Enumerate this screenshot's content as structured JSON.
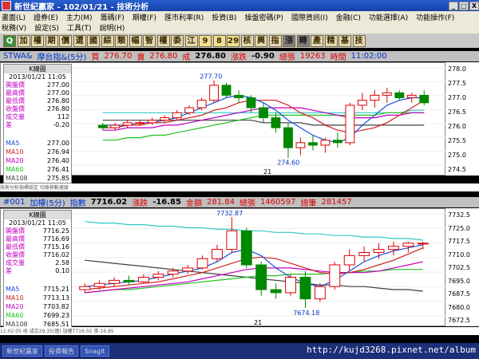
{
  "window": {
    "title": "新世紀贏家 - 102/01/21 - 技術分析",
    "buttons": [
      "_",
      "□",
      "X"
    ]
  },
  "menu": {
    "row1": [
      "畫面(L)",
      "證券(E)",
      "主力(M)",
      "籌碼(F)",
      "期權(F)",
      "匯市利率(R)",
      "投資(B)",
      "操盤密碼(P)",
      "國際資訊(I)",
      "金融(C)",
      "功能選擇(A)",
      "功能操作(F)"
    ],
    "row2": [
      "稅務(V)",
      "設定(S)",
      "工具(T)",
      "說明(H)"
    ]
  },
  "toolbar": [
    "Q",
    "加",
    "權",
    "期",
    "價",
    "選",
    "國",
    "綜",
    "類",
    "幅",
    "智",
    "權",
    "委",
    "江",
    "9",
    "8",
    "29",
    "核",
    "興",
    "指",
    "漲",
    "轉",
    "產",
    "精",
    "基",
    "技"
  ],
  "panel1": {
    "header": {
      "symbol": "STWA&",
      "name": "摩台指&(5分)",
      "buy_label": "買",
      "buy": "276.70",
      "sell_label": "賣",
      "sell": "276.80",
      "deal_label": "成",
      "deal": "276.80",
      "chg_label": "漲跌",
      "chg": "-0.90",
      "vol_label": "總張",
      "vol": "19263",
      "time_label": "時間",
      "time": "11:02:00"
    },
    "info": {
      "title": "K線圖",
      "date": "2013/01/21 11:05",
      "rows": [
        [
          "開盤價",
          "277.00"
        ],
        [
          "最高價",
          "277.00"
        ],
        [
          "最低價",
          "276.80"
        ],
        [
          "收盤價",
          "276.80"
        ],
        [
          "成交量",
          "112"
        ],
        [
          "差",
          "-0.20"
        ]
      ],
      "ma": [
        [
          "MA5",
          "277.00"
        ],
        [
          "MA10",
          "276.94"
        ],
        [
          "MA20",
          "276.40"
        ],
        [
          "MA60",
          "276.41"
        ],
        [
          "MA108",
          "275.85"
        ]
      ]
    },
    "annot_high": "277.70",
    "annot_low": "274.60",
    "date_mark": "21",
    "axis": [
      "278.0",
      "277.5",
      "277.0",
      "276.5",
      "276.0",
      "275.5",
      "275.0",
      "274.5"
    ],
    "chart_data": {
      "type": "candlestick",
      "ylim": [
        274.3,
        278.2
      ],
      "candles": [
        [
          275.9,
          276.0,
          275.7,
          275.8
        ],
        [
          275.8,
          276.0,
          275.7,
          275.9
        ],
        [
          275.9,
          276.1,
          275.8,
          276.0
        ],
        [
          276.0,
          276.1,
          275.9,
          276.0
        ],
        [
          276.0,
          276.2,
          275.9,
          276.1
        ],
        [
          276.1,
          276.3,
          276.0,
          276.2
        ],
        [
          276.2,
          276.5,
          276.1,
          276.4
        ],
        [
          276.4,
          276.7,
          276.3,
          276.6
        ],
        [
          276.6,
          277.0,
          276.5,
          276.9
        ],
        [
          276.9,
          277.7,
          276.8,
          277.5
        ],
        [
          277.5,
          277.6,
          277.0,
          277.1
        ],
        [
          277.1,
          277.3,
          276.8,
          277.0
        ],
        [
          277.0,
          277.1,
          276.4,
          276.6
        ],
        [
          276.6,
          276.8,
          276.0,
          276.2
        ],
        [
          276.2,
          276.4,
          275.6,
          275.8
        ],
        [
          275.8,
          276.0,
          274.6,
          275.0
        ],
        [
          275.0,
          275.4,
          274.7,
          275.2
        ],
        [
          275.2,
          275.5,
          274.9,
          275.1
        ],
        [
          275.1,
          275.4,
          274.8,
          275.3
        ],
        [
          275.3,
          275.6,
          275.0,
          275.2
        ],
        [
          275.2,
          276.8,
          275.1,
          276.7
        ],
        [
          276.7,
          277.2,
          276.5,
          276.9
        ],
        [
          276.9,
          277.3,
          276.6,
          277.1
        ],
        [
          277.1,
          277.4,
          276.8,
          277.2
        ],
        [
          277.2,
          277.3,
          276.9,
          277.0
        ],
        [
          277.0,
          277.2,
          276.8,
          277.1
        ],
        [
          277.1,
          277.3,
          276.7,
          276.8
        ]
      ],
      "series": [
        {
          "color": "#1a4fd8",
          "values": [
            275.9,
            275.9,
            275.9,
            276.0,
            276.0,
            276.1,
            276.2,
            276.4,
            276.6,
            276.8,
            277.0,
            277.1,
            277.0,
            276.8,
            276.5,
            276.1,
            275.8,
            275.5,
            275.3,
            275.2,
            275.4,
            275.9,
            276.3,
            276.7,
            276.9,
            277.0,
            277.0
          ]
        },
        {
          "color": "#d02020",
          "values": [
            275.8,
            275.8,
            275.9,
            275.9,
            276.0,
            276.0,
            276.1,
            276.2,
            276.3,
            276.5,
            276.6,
            276.8,
            276.9,
            276.9,
            276.9,
            276.7,
            276.4,
            276.2,
            275.9,
            275.7,
            275.6,
            275.7,
            275.8,
            276.0,
            276.3,
            276.6,
            276.9
          ]
        },
        {
          "color": "#c000c0",
          "values": [
            275.7,
            275.7,
            275.8,
            275.8,
            275.8,
            275.9,
            275.9,
            276.0,
            276.1,
            276.2,
            276.3,
            276.4,
            276.5,
            276.6,
            276.6,
            276.6,
            276.6,
            276.5,
            276.4,
            276.3,
            276.2,
            276.2,
            276.2,
            276.3,
            276.3,
            276.4,
            276.4
          ]
        },
        {
          "color": "#20c020",
          "values": [
            275.3,
            275.3,
            275.4,
            275.4,
            275.5,
            275.5,
            275.6,
            275.7,
            275.8,
            275.9,
            276.0,
            276.1,
            276.2,
            276.3,
            276.3,
            276.3,
            276.3,
            276.3,
            276.3,
            276.3,
            276.3,
            276.3,
            276.3,
            276.4,
            276.4,
            276.4,
            276.4
          ]
        },
        {
          "color": "#404040",
          "values": [
            276.1,
            276.1,
            276.1,
            276.1,
            276.1,
            276.1,
            276.1,
            276.1,
            276.1,
            276.1,
            276.1,
            276.1,
            276.1,
            276.0,
            276.0,
            276.0,
            276.0,
            275.9,
            275.9,
            275.9,
            275.9,
            275.9,
            275.9,
            275.9,
            275.9,
            275.9,
            275.9
          ]
        },
        {
          "color": "#30c8c8",
          "values": [
            276.4,
            276.4,
            276.4,
            276.4,
            276.4,
            276.4,
            276.4,
            276.4,
            276.4,
            276.4,
            276.4,
            276.4,
            276.4,
            276.4,
            276.4,
            276.4,
            276.4,
            276.4,
            276.4,
            276.4,
            276.4,
            276.4,
            276.4,
            276.4,
            276.4,
            276.5,
            276.5
          ]
        }
      ]
    }
  },
  "panel2": {
    "header": {
      "symbol": "#001",
      "name": "加權(5分)",
      "idx_label": "指數",
      "idx": "7716.02",
      "chg_label": "漲跌",
      "chg": "-16.85",
      "amt_label": "金額",
      "amt": "281.84",
      "vol_label": "總張",
      "vol": "1460597",
      "cnt_label": "總筆",
      "cnt": "281457"
    },
    "info": {
      "title": "K線圖",
      "date": "2013/01/21 11:05",
      "rows": [
        [
          "開盤價",
          "7716.25"
        ],
        [
          "最高價",
          "7716.69"
        ],
        [
          "最低價",
          "7715.16"
        ],
        [
          "收盤價",
          "7716.02"
        ],
        [
          "成交量",
          "2.58"
        ],
        [
          "差",
          "0.10"
        ]
      ],
      "ma": [
        [
          "MA5",
          "7715.21"
        ],
        [
          "MA10",
          "7713.13"
        ],
        [
          "MA20",
          "7703.82"
        ],
        [
          "MA60",
          "7699.23"
        ],
        [
          "MA108",
          "7685.51"
        ]
      ]
    },
    "annot_high": "7732.87",
    "annot_low": "7674.18",
    "date_mark": "21",
    "axis": [
      "7732.5",
      "7725.0",
      "7717.5",
      "7710.0",
      "7702.5",
      "7695.0",
      "7687.5",
      "7680.0",
      "7672.5"
    ],
    "chart_data": {
      "type": "candlestick",
      "ylim": [
        7669,
        7735
      ],
      "candles": [
        [
          7686,
          7690,
          7684,
          7688
        ],
        [
          7688,
          7692,
          7686,
          7690
        ],
        [
          7690,
          7694,
          7688,
          7692
        ],
        [
          7692,
          7695,
          7689,
          7691
        ],
        [
          7691,
          7696,
          7690,
          7694
        ],
        [
          7694,
          7698,
          7692,
          7696
        ],
        [
          7696,
          7700,
          7694,
          7698
        ],
        [
          7698,
          7702,
          7696,
          7700
        ],
        [
          7700,
          7708,
          7699,
          7706
        ],
        [
          7706,
          7715,
          7704,
          7712
        ],
        [
          7712,
          7732.9,
          7710,
          7724
        ],
        [
          7724,
          7726,
          7700,
          7702
        ],
        [
          7702,
          7704,
          7682,
          7686
        ],
        [
          7686,
          7690,
          7680,
          7684
        ],
        [
          7684,
          7696,
          7682,
          7694
        ],
        [
          7694,
          7698,
          7674.2,
          7680
        ],
        [
          7680,
          7690,
          7678,
          7688
        ],
        [
          7688,
          7704,
          7686,
          7702
        ],
        [
          7702,
          7712,
          7698,
          7708
        ],
        [
          7708,
          7714,
          7704,
          7710
        ],
        [
          7710,
          7716,
          7706,
          7712
        ],
        [
          7712,
          7717,
          7708,
          7714
        ],
        [
          7714,
          7717,
          7710,
          7716
        ],
        [
          7716,
          7717,
          7712,
          7716
        ]
      ],
      "series": [
        {
          "color": "#1a4fd8",
          "values": [
            7688,
            7689,
            7690,
            7691,
            7692,
            7694,
            7696,
            7698,
            7700,
            7704,
            7710,
            7712,
            7708,
            7700,
            7694,
            7690,
            7688,
            7692,
            7698,
            7704,
            7708,
            7711,
            7713,
            7715
          ]
        },
        {
          "color": "#d02020",
          "values": [
            7686,
            7687,
            7688,
            7689,
            7690,
            7691,
            7693,
            7695,
            7697,
            7700,
            7703,
            7706,
            7707,
            7706,
            7703,
            7700,
            7697,
            7696,
            7697,
            7699,
            7702,
            7705,
            7709,
            7713
          ]
        },
        {
          "color": "#c000c0",
          "values": [
            7684,
            7685,
            7686,
            7687,
            7688,
            7689,
            7690,
            7691,
            7693,
            7695,
            7697,
            7699,
            7700,
            7700,
            7700,
            7699,
            7698,
            7697,
            7697,
            7697,
            7698,
            7700,
            7702,
            7704
          ]
        },
        {
          "color": "#20c020",
          "values": [
            7684,
            7685,
            7686,
            7686,
            7687,
            7688,
            7689,
            7690,
            7691,
            7692,
            7693,
            7694,
            7695,
            7695,
            7696,
            7696,
            7696,
            7697,
            7697,
            7698,
            7698,
            7699,
            7699,
            7699
          ]
        },
        {
          "color": "#404040",
          "values": [
            7705,
            7704,
            7703,
            7702,
            7701,
            7700,
            7699,
            7698,
            7697,
            7696,
            7695,
            7694,
            7693,
            7692,
            7691,
            7690,
            7689,
            7689,
            7688,
            7688,
            7687,
            7686,
            7686,
            7685
          ]
        },
        {
          "color": "#30c8c8",
          "values": [
            7730,
            7729,
            7729,
            7728,
            7728,
            7727,
            7727,
            7726,
            7726,
            7725,
            7725,
            7724,
            7724,
            7723,
            7723,
            7722,
            7722,
            7721,
            7721,
            7720,
            7720,
            7719,
            7719,
            7718
          ]
        }
      ]
    }
  },
  "footer1": "技術分析指標設定  切換移動速度",
  "footer2": "11:02:05  收  成交29.35(億)  加權7716.02  漲-16.85",
  "taskbar": [
    "新世紀贏家",
    "投資報告",
    "Snaglt"
  ],
  "watermark": "http://kujd3268.pixnet.net/album"
}
